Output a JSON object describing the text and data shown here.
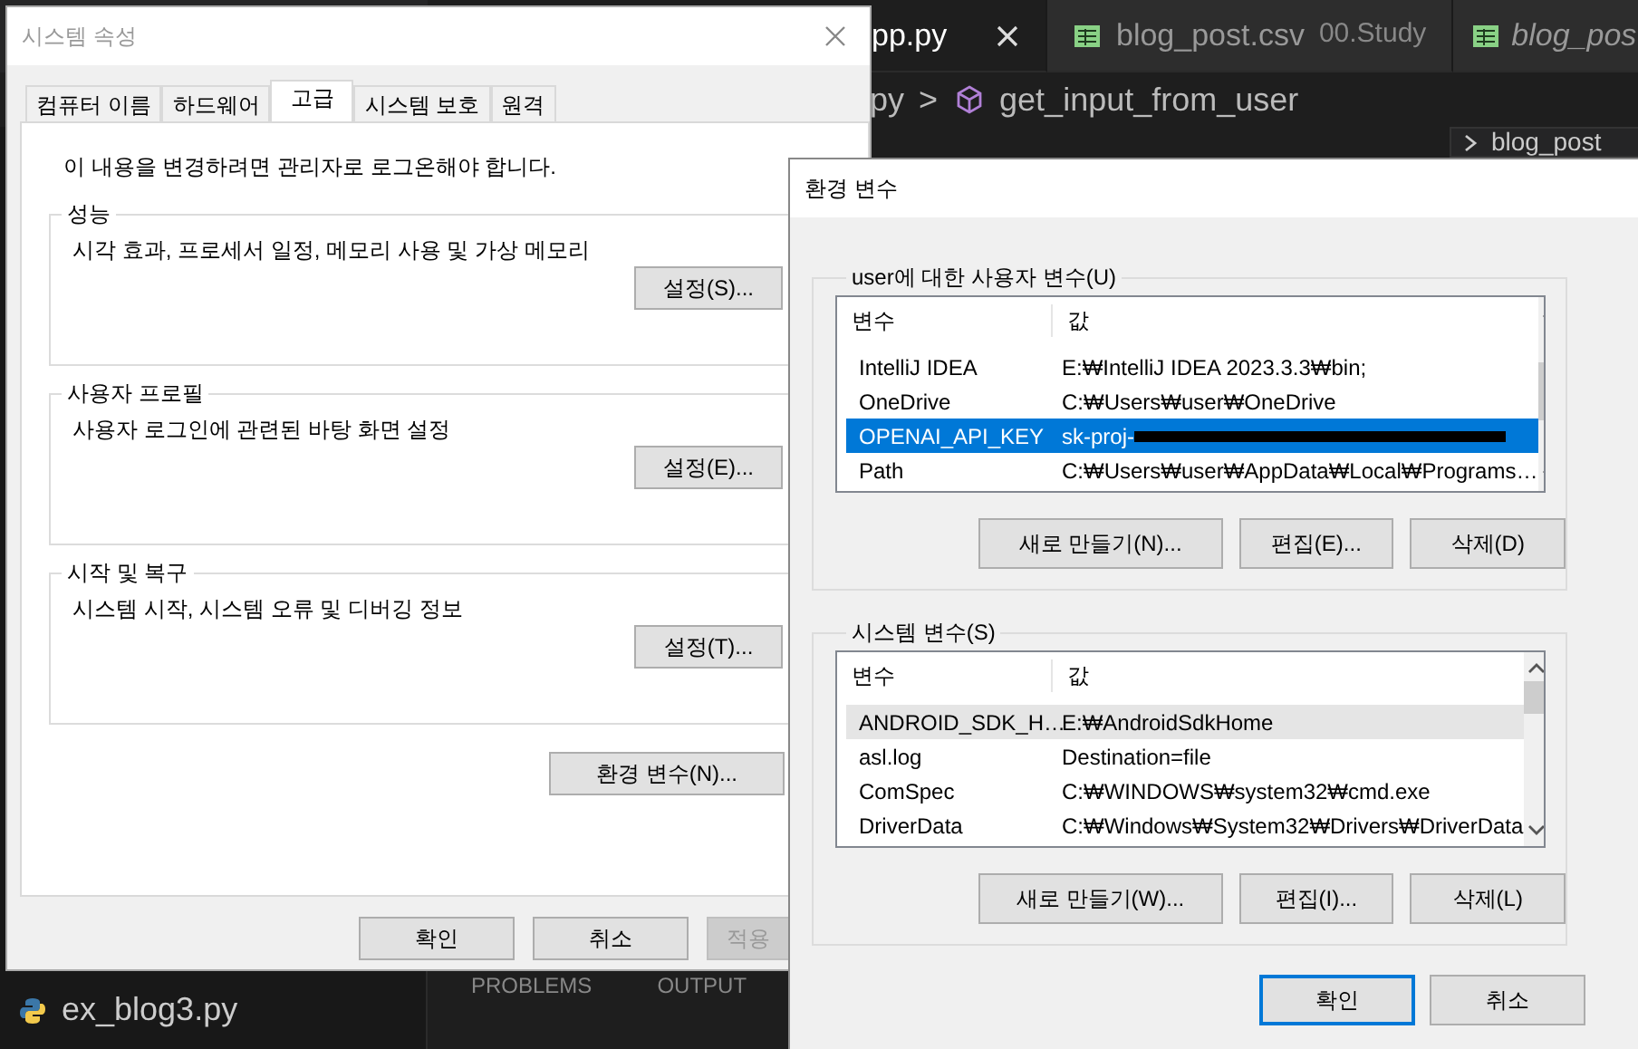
{
  "editor": {
    "tabs": [
      {
        "label": "pp.py",
        "selected": true,
        "preview": false
      },
      {
        "label": "blog_post.csv",
        "description": "00.Study",
        "kind": "csv",
        "selected": false,
        "preview": false
      },
      {
        "label": "blog_pos",
        "kind": "csv",
        "selected": false,
        "preview": true
      }
    ],
    "breadcrumb": {
      "parent": "py",
      "separator": ">",
      "symbol": "get_input_from_user"
    },
    "outline_title": "blog_post",
    "files": [
      {
        "label": "ex_blog3.py",
        "kind": "python"
      }
    ],
    "panel_tabs": [
      "PROBLEMS",
      "OUTPUT"
    ]
  },
  "system_properties": {
    "title": "시스템 속성",
    "active": false,
    "tabs": [
      {
        "label": "컴퓨터 이름",
        "selected": false
      },
      {
        "label": "하드웨어",
        "selected": false
      },
      {
        "label": "고급",
        "selected": true
      },
      {
        "label": "시스템 보호",
        "selected": false
      },
      {
        "label": "원격",
        "selected": false
      }
    ],
    "notice": "이 내용을 변경하려면 관리자로 로그온해야 합니다.",
    "groups": [
      {
        "title": "성능",
        "description": "시각 효과, 프로세서 일정, 메모리 사용 및 가상 메모리",
        "button": "설정(S)..."
      },
      {
        "title": "사용자 프로필",
        "description": "사용자 로그인에 관련된 바탕 화면 설정",
        "button": "설정(E)..."
      },
      {
        "title": "시작 및 복구",
        "description": "시스템 시작, 시스템 오류 및 디버깅 정보",
        "button": "설정(T)..."
      }
    ],
    "env_button": "환경 변수(N)...",
    "buttons": [
      {
        "label": "확인",
        "disabled": false
      },
      {
        "label": "취소",
        "disabled": false
      },
      {
        "label": "적용",
        "disabled": true
      }
    ]
  },
  "environment_variables": {
    "title": "환경 변수",
    "active": true,
    "sections": [
      {
        "title": "user에 대한 사용자 변수(U)",
        "columns": [
          "변수",
          "값"
        ],
        "rows": [
          {
            "name": "IntelliJ IDEA",
            "value": "E:₩IntelliJ IDEA 2023.3.3₩bin;",
            "selected": false,
            "hovered": false,
            "redacted": false
          },
          {
            "name": "OneDrive",
            "value": "C:₩Users₩user₩OneDrive",
            "selected": false,
            "hovered": false,
            "redacted": false
          },
          {
            "name": "OPENAI_API_KEY",
            "value": "sk-proj-",
            "selected": true,
            "hovered": false,
            "redacted": true
          },
          {
            "name": "Path",
            "value": "C:₩Users₩user₩AppData₩Local₩Programs…",
            "selected": false,
            "hovered": false,
            "redacted": false
          }
        ],
        "buttons": [
          "새로 만들기(N)...",
          "편집(E)...",
          "삭제(D)"
        ]
      },
      {
        "title": "시스템 변수(S)",
        "columns": [
          "변수",
          "값"
        ],
        "rows": [
          {
            "name": "ANDROID_SDK_H…",
            "value": "E:₩AndroidSdkHome",
            "selected": false,
            "hovered": true,
            "redacted": false
          },
          {
            "name": "asl.log",
            "value": "Destination=file",
            "selected": false,
            "hovered": false,
            "redacted": false
          },
          {
            "name": "ComSpec",
            "value": "C:₩WINDOWS₩system32₩cmd.exe",
            "selected": false,
            "hovered": false,
            "redacted": false
          },
          {
            "name": "DriverData",
            "value": "C:₩Windows₩System32₩Drivers₩DriverData",
            "selected": false,
            "hovered": false,
            "redacted": false
          }
        ],
        "buttons": [
          "새로 만들기(W)...",
          "편집(I)...",
          "삭제(L)"
        ]
      }
    ],
    "buttons": [
      {
        "label": "확인",
        "default": true
      },
      {
        "label": "취소",
        "default": false
      }
    ]
  }
}
